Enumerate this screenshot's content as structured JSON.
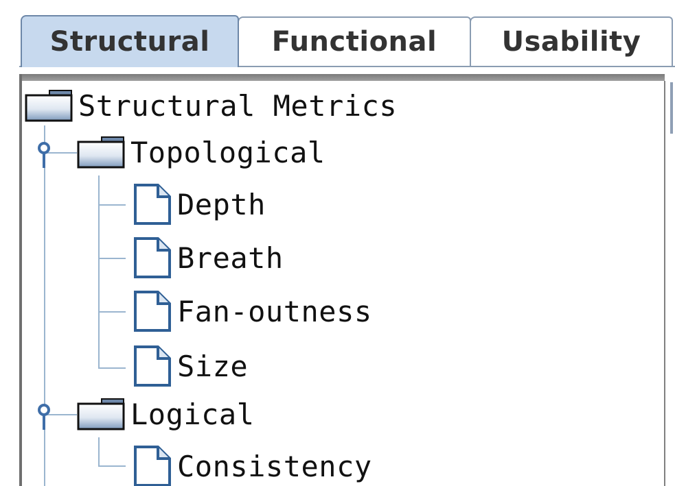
{
  "tabs": [
    {
      "label": "Structural",
      "active": true
    },
    {
      "label": "Functional",
      "active": false
    },
    {
      "label": "Usability",
      "active": false
    }
  ],
  "tree": {
    "root": {
      "label": "Structural Metrics",
      "icon": "folder-icon"
    },
    "topological": {
      "label": "Topological",
      "icon": "folder-icon",
      "expanded": true,
      "children": [
        {
          "label": "Depth",
          "icon": "document-icon"
        },
        {
          "label": "Breath",
          "icon": "document-icon"
        },
        {
          "label": "Fan-outness",
          "icon": "document-icon"
        },
        {
          "label": "Size",
          "icon": "document-icon"
        }
      ]
    },
    "logical": {
      "label": "Logical",
      "icon": "folder-icon",
      "expanded": true,
      "children": [
        {
          "label": "Consistency",
          "icon": "document-icon"
        }
      ]
    }
  },
  "colors": {
    "active_tab": "#c7d9ee",
    "tab_border": "#8a9cb2",
    "tree_lines": "#9ab5cf",
    "expander": "#3f6ea8",
    "icon_outline": "#2f5f95"
  }
}
